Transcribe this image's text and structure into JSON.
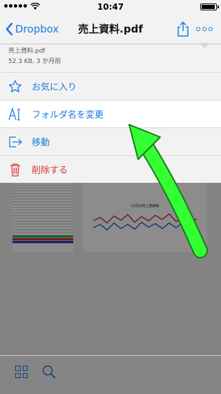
{
  "status_bar": {
    "time": "10:47",
    "battery_level": 0.95
  },
  "nav": {
    "back_label": "Dropbox",
    "title": "売上資料.pdf"
  },
  "file": {
    "name": "売上資料.pdf",
    "meta": "52.3 KB, 3 か月前"
  },
  "menu": [
    {
      "label": "お気に入り",
      "icon": "star-icon",
      "danger": false,
      "highlight": false
    },
    {
      "label": "フォルダ名を変更",
      "icon": "rename-icon",
      "danger": false,
      "highlight": true
    },
    {
      "label": "移動",
      "icon": "move-icon",
      "danger": false,
      "highlight": false
    },
    {
      "label": "削除する",
      "icon": "trash-icon",
      "danger": true,
      "highlight": false
    }
  ],
  "preview": {
    "chart_title": "12月の売上額推移"
  },
  "colors": {
    "accent": "#1a7ae0",
    "danger": "#dd3333",
    "arrow": "#33ff33"
  }
}
